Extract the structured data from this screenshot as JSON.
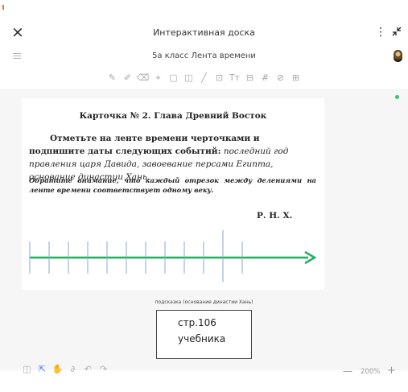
{
  "window": {
    "title": "Интерактивная доска",
    "more_glyph": "⋮"
  },
  "board": {
    "name": "5а класс Лента времени"
  },
  "toolbar": {
    "tools": [
      {
        "name": "pen-icon",
        "glyph": "✎"
      },
      {
        "name": "marker-icon",
        "glyph": "✐"
      },
      {
        "name": "eraser-icon",
        "glyph": "⌫"
      },
      {
        "name": "lasso-icon",
        "glyph": "⌖"
      },
      {
        "name": "shape-icon",
        "glyph": "▢"
      },
      {
        "name": "sticky-note-icon",
        "glyph": "◫"
      },
      {
        "name": "line-icon",
        "glyph": "╱"
      },
      {
        "name": "image-icon",
        "glyph": "⊡"
      },
      {
        "name": "text-icon",
        "glyph": "Tт"
      },
      {
        "name": "frame-icon",
        "glyph": "⊟"
      },
      {
        "name": "grid-icon",
        "glyph": "#"
      },
      {
        "name": "attachment-icon",
        "glyph": "⊘"
      },
      {
        "name": "table-icon",
        "glyph": "⊞"
      }
    ]
  },
  "card": {
    "title": "Карточка № 2. Глава Древний Восток",
    "task_bold": "Отметьте на ленте времени черточками и подпишите даты следующих событий:",
    "task_italic": "последний год правления царя Давида, завоевание персами Египта, основание династии Хань.",
    "note": "Обратите внимание, что каждый отрезок между делениями на ленте времени соответствует одному веку.",
    "era_label": "Р. Н. Х."
  },
  "timeline": {
    "tick_count": 12,
    "era_tick_index": 10,
    "line_color": "#1fae5b",
    "tick_color": "#8aa6d6"
  },
  "hint": {
    "label": "подсказка (основание династии Хань)",
    "line1": "стр.106",
    "line2": "учебника"
  },
  "bottom_toolbar": {
    "tools": [
      {
        "name": "panel-icon",
        "glyph": "◫"
      },
      {
        "name": "select-cursor-icon",
        "glyph": "⇱",
        "active": true
      },
      {
        "name": "hand-icon",
        "glyph": "✋"
      },
      {
        "name": "laser-icon",
        "glyph": "∂"
      },
      {
        "name": "undo-icon",
        "glyph": "↶"
      },
      {
        "name": "redo-icon",
        "glyph": "↷"
      }
    ]
  },
  "zoom": {
    "minus": "—",
    "value": "200%",
    "plus": "+"
  }
}
